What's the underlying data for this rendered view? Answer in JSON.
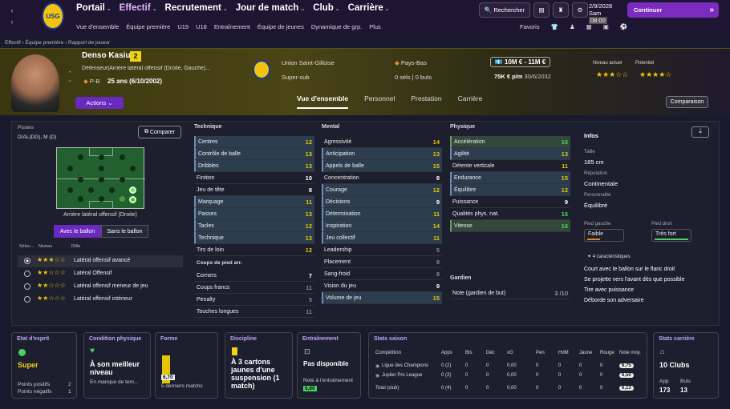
{
  "nav": {
    "menu": [
      "Portail",
      "Effectif",
      "Recrutement",
      "Jour de match",
      "Club",
      "Carrière"
    ],
    "active": "Effectif",
    "submenu": [
      "Vue d'ensemble",
      "Équipe première",
      "U19",
      "U18",
      "Entraînement",
      "Équipe de jeunes",
      "Dynamique de grp.",
      "Plus"
    ],
    "search": "Rechercher",
    "date": "2/9/2028",
    "day": "Sam",
    "time": "08:00",
    "continue": "Continuer",
    "favs": "Favoris",
    "logo": "USG"
  },
  "breadcrumb": "Effectif  ›  Équipe première  ›  Rapport de joueur",
  "player": {
    "name": "Denso Kasius",
    "number": "2",
    "desc": "Défenseur|Arrière latéral offensif (Droite, Gauche)...",
    "pos": "P-B",
    "age": "25 ans (6/10/2002)",
    "actions": "Actions",
    "club": "Union Saint-Gilloise",
    "role": "Super-sub",
    "nation": "Pays-Bas",
    "goals": "0 séls | 0 buts",
    "value": "10M € - 11M €",
    "wage": "75K € p/m",
    "contract": "30/6/2032",
    "level_lbl": "Niveau actuel",
    "pot_lbl": "Potentiel",
    "level_stars": "★★★☆☆",
    "pot_stars": "★★★★☆"
  },
  "tabs": [
    "Vue d'ensemble",
    "Personnel",
    "Prestation",
    "Carrière"
  ],
  "comparaison": "Comparaison",
  "left": {
    "postes": "Postes",
    "postes_val": "D/AL(DG), M (D)",
    "comparer": "Comparer",
    "pitch_label": "Arrière latéral offensif (Droite)",
    "with_ball": "Avec le ballon",
    "without_ball": "Sans le ballon",
    "hdr": [
      "Sélec...",
      "Niveau",
      "Rôle"
    ],
    "roles": [
      {
        "stars": "★★★☆☆",
        "name": "Latéral offensif avancé",
        "sel": true
      },
      {
        "stars": "★★☆☆☆",
        "name": "Latéral Offensif",
        "sel": false
      },
      {
        "stars": "★★☆☆☆",
        "name": "Latéral offensif meneur de jeu",
        "sel": false
      },
      {
        "stars": "★★☆☆☆",
        "name": "Latéral offensif intérieur",
        "sel": false
      }
    ]
  },
  "technique": {
    "title": "Technique",
    "rows": [
      [
        "Centres",
        "12",
        "y"
      ],
      [
        "Contrôle de balle",
        "13",
        "y"
      ],
      [
        "Dribbles",
        "13",
        "y"
      ],
      [
        "Finition",
        "10",
        "w"
      ],
      [
        "Jeu de tête",
        "8",
        "w"
      ],
      [
        "Marquage",
        "11",
        "y"
      ],
      [
        "Passes",
        "13",
        "y"
      ],
      [
        "Tacles",
        "12",
        "y"
      ],
      [
        "Technique",
        "13",
        "y"
      ],
      [
        "Tirs de loin",
        "12",
        "y"
      ]
    ],
    "setpieces_title": "Coups de pied arr.",
    "setpieces": [
      [
        "Corners",
        "7",
        "w"
      ],
      [
        "Coups francs",
        "11",
        "gr"
      ],
      [
        "Penalty",
        "5",
        "gr"
      ],
      [
        "Touches longues",
        "11",
        "gr"
      ]
    ]
  },
  "mental": {
    "title": "Mental",
    "rows": [
      [
        "Agressivité",
        "14",
        "y"
      ],
      [
        "Anticipation",
        "13",
        "y"
      ],
      [
        "Appels de balle",
        "15",
        "y"
      ],
      [
        "Concentration",
        "8",
        "w"
      ],
      [
        "Courage",
        "12",
        "y"
      ],
      [
        "Décisions",
        "9",
        "w"
      ],
      [
        "Détermination",
        "11",
        "y"
      ],
      [
        "Inspiration",
        "14",
        "y"
      ],
      [
        "Jeu collectif",
        "11",
        "y"
      ],
      [
        "Leadership",
        "5",
        "gr"
      ],
      [
        "Placement",
        "9",
        "gr"
      ],
      [
        "Sang-froid",
        "8",
        "gr"
      ],
      [
        "Vision du jeu",
        "9",
        "w"
      ],
      [
        "Volume de jeu",
        "15",
        "y"
      ]
    ]
  },
  "physique": {
    "title": "Physique",
    "rows": [
      [
        "Accélération",
        "16",
        "g"
      ],
      [
        "Agilité",
        "13",
        "y"
      ],
      [
        "Détente verticale",
        "11",
        "y"
      ],
      [
        "Endurance",
        "15",
        "y"
      ],
      [
        "Équilibre",
        "12",
        "y"
      ],
      [
        "Puissance",
        "9",
        "w"
      ],
      [
        "Qualités phys. nat.",
        "16",
        "g"
      ],
      [
        "Vitesse",
        "16",
        "g"
      ]
    ],
    "gardien_title": "Gardien",
    "gardien": [
      [
        "Note (gardien de but)",
        "3 /10"
      ]
    ]
  },
  "info": {
    "title": "Infos",
    "taille_lbl": "Taille",
    "taille": "185 cm",
    "rep_lbl": "Réputation",
    "rep": "Continentale",
    "pers_lbl": "Personnalité",
    "pers": "Équilibré",
    "pg_lbl": "Pied gauche",
    "pg": "Faible",
    "pd_lbl": "Pied droit",
    "pd": "Très fort",
    "car_title": "4 caractéristiques",
    "traits": [
      "Court avec le ballon sur le flanc droit",
      "Se projette vers l'avant dès que possible",
      "Tire avec puissance",
      "Déborde son adversaire"
    ]
  },
  "cards": {
    "esprit": {
      "title": "Etat d'esprit",
      "val": "Super",
      "pp": "Points positifs",
      "pn": "Points négatifs",
      "ppv": "2",
      "pnv": "1"
    },
    "physique": {
      "title": "Condition physique",
      "val": "À son meilleur niveau",
      "sub": "En manque de tem..."
    },
    "forme": {
      "title": "Forme",
      "val": "6,70",
      "sub": "5 derniers matchs"
    },
    "discipline": {
      "title": "Discipline",
      "val": "À 3 cartons jaunes d'une suspension (1 match)"
    },
    "entrainement": {
      "title": "Entraînement",
      "val": "Pas disponible",
      "sub": "Note à l'entraînement",
      "note": "6,80"
    },
    "saison": {
      "title": "Stats saison",
      "headers": [
        "Compétition",
        "Apps",
        "Bts",
        "Déc",
        "xG",
        "Pen",
        "HdM",
        "Jaune",
        "Rouge",
        "Note moy."
      ],
      "rows": [
        [
          "Ligue des Champions",
          "0 (2)",
          "0",
          "0",
          "0,00",
          "0",
          "0",
          "0",
          "0",
          "6,75"
        ],
        [
          "Jupiler Pro League",
          "0 (2)",
          "0",
          "0",
          "0,00",
          "0",
          "0",
          "0",
          "0",
          "6,50"
        ],
        [
          "Total (club)",
          "0 (4)",
          "0",
          "0",
          "0,00",
          "0",
          "0",
          "0",
          "0",
          "6,13"
        ]
      ]
    },
    "carriere": {
      "title": "Stats carrière",
      "val": "10 Clubs",
      "app_lbl": "App",
      "buts_lbl": "Buts",
      "app": "173",
      "buts": "13"
    }
  }
}
